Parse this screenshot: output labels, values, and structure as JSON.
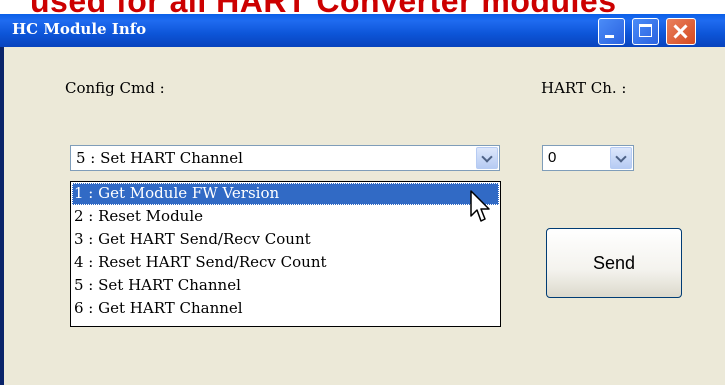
{
  "banner": {
    "text": "used for all HART Converter modules"
  },
  "window": {
    "title": "HC Module Info",
    "controls": {
      "minimize": "minimize-icon",
      "maximize": "maximize-icon",
      "close": "close-icon"
    }
  },
  "config": {
    "label": "Config Cmd :",
    "selected": "5 : Set HART Channel",
    "options": [
      "1 : Get Module FW Version",
      "2 : Reset Module",
      "3 : Get HART Send/Recv Count",
      "4 : Reset HART Send/Recv Count",
      "5 : Set HART Channel",
      "6 : Get HART Channel"
    ],
    "highlighted_index": 0
  },
  "hart": {
    "label": "HART Ch. :",
    "selected": "0"
  },
  "send_button": {
    "label": "Send"
  },
  "colors": {
    "title_bar": "#0a5fe8",
    "selection": "#316ac5",
    "banner_text": "#cc0000",
    "dialog_bg": "#ece9d8"
  },
  "icons": {
    "dropdown": "chevron-down-icon",
    "pointer": "mouse-cursor-icon"
  }
}
